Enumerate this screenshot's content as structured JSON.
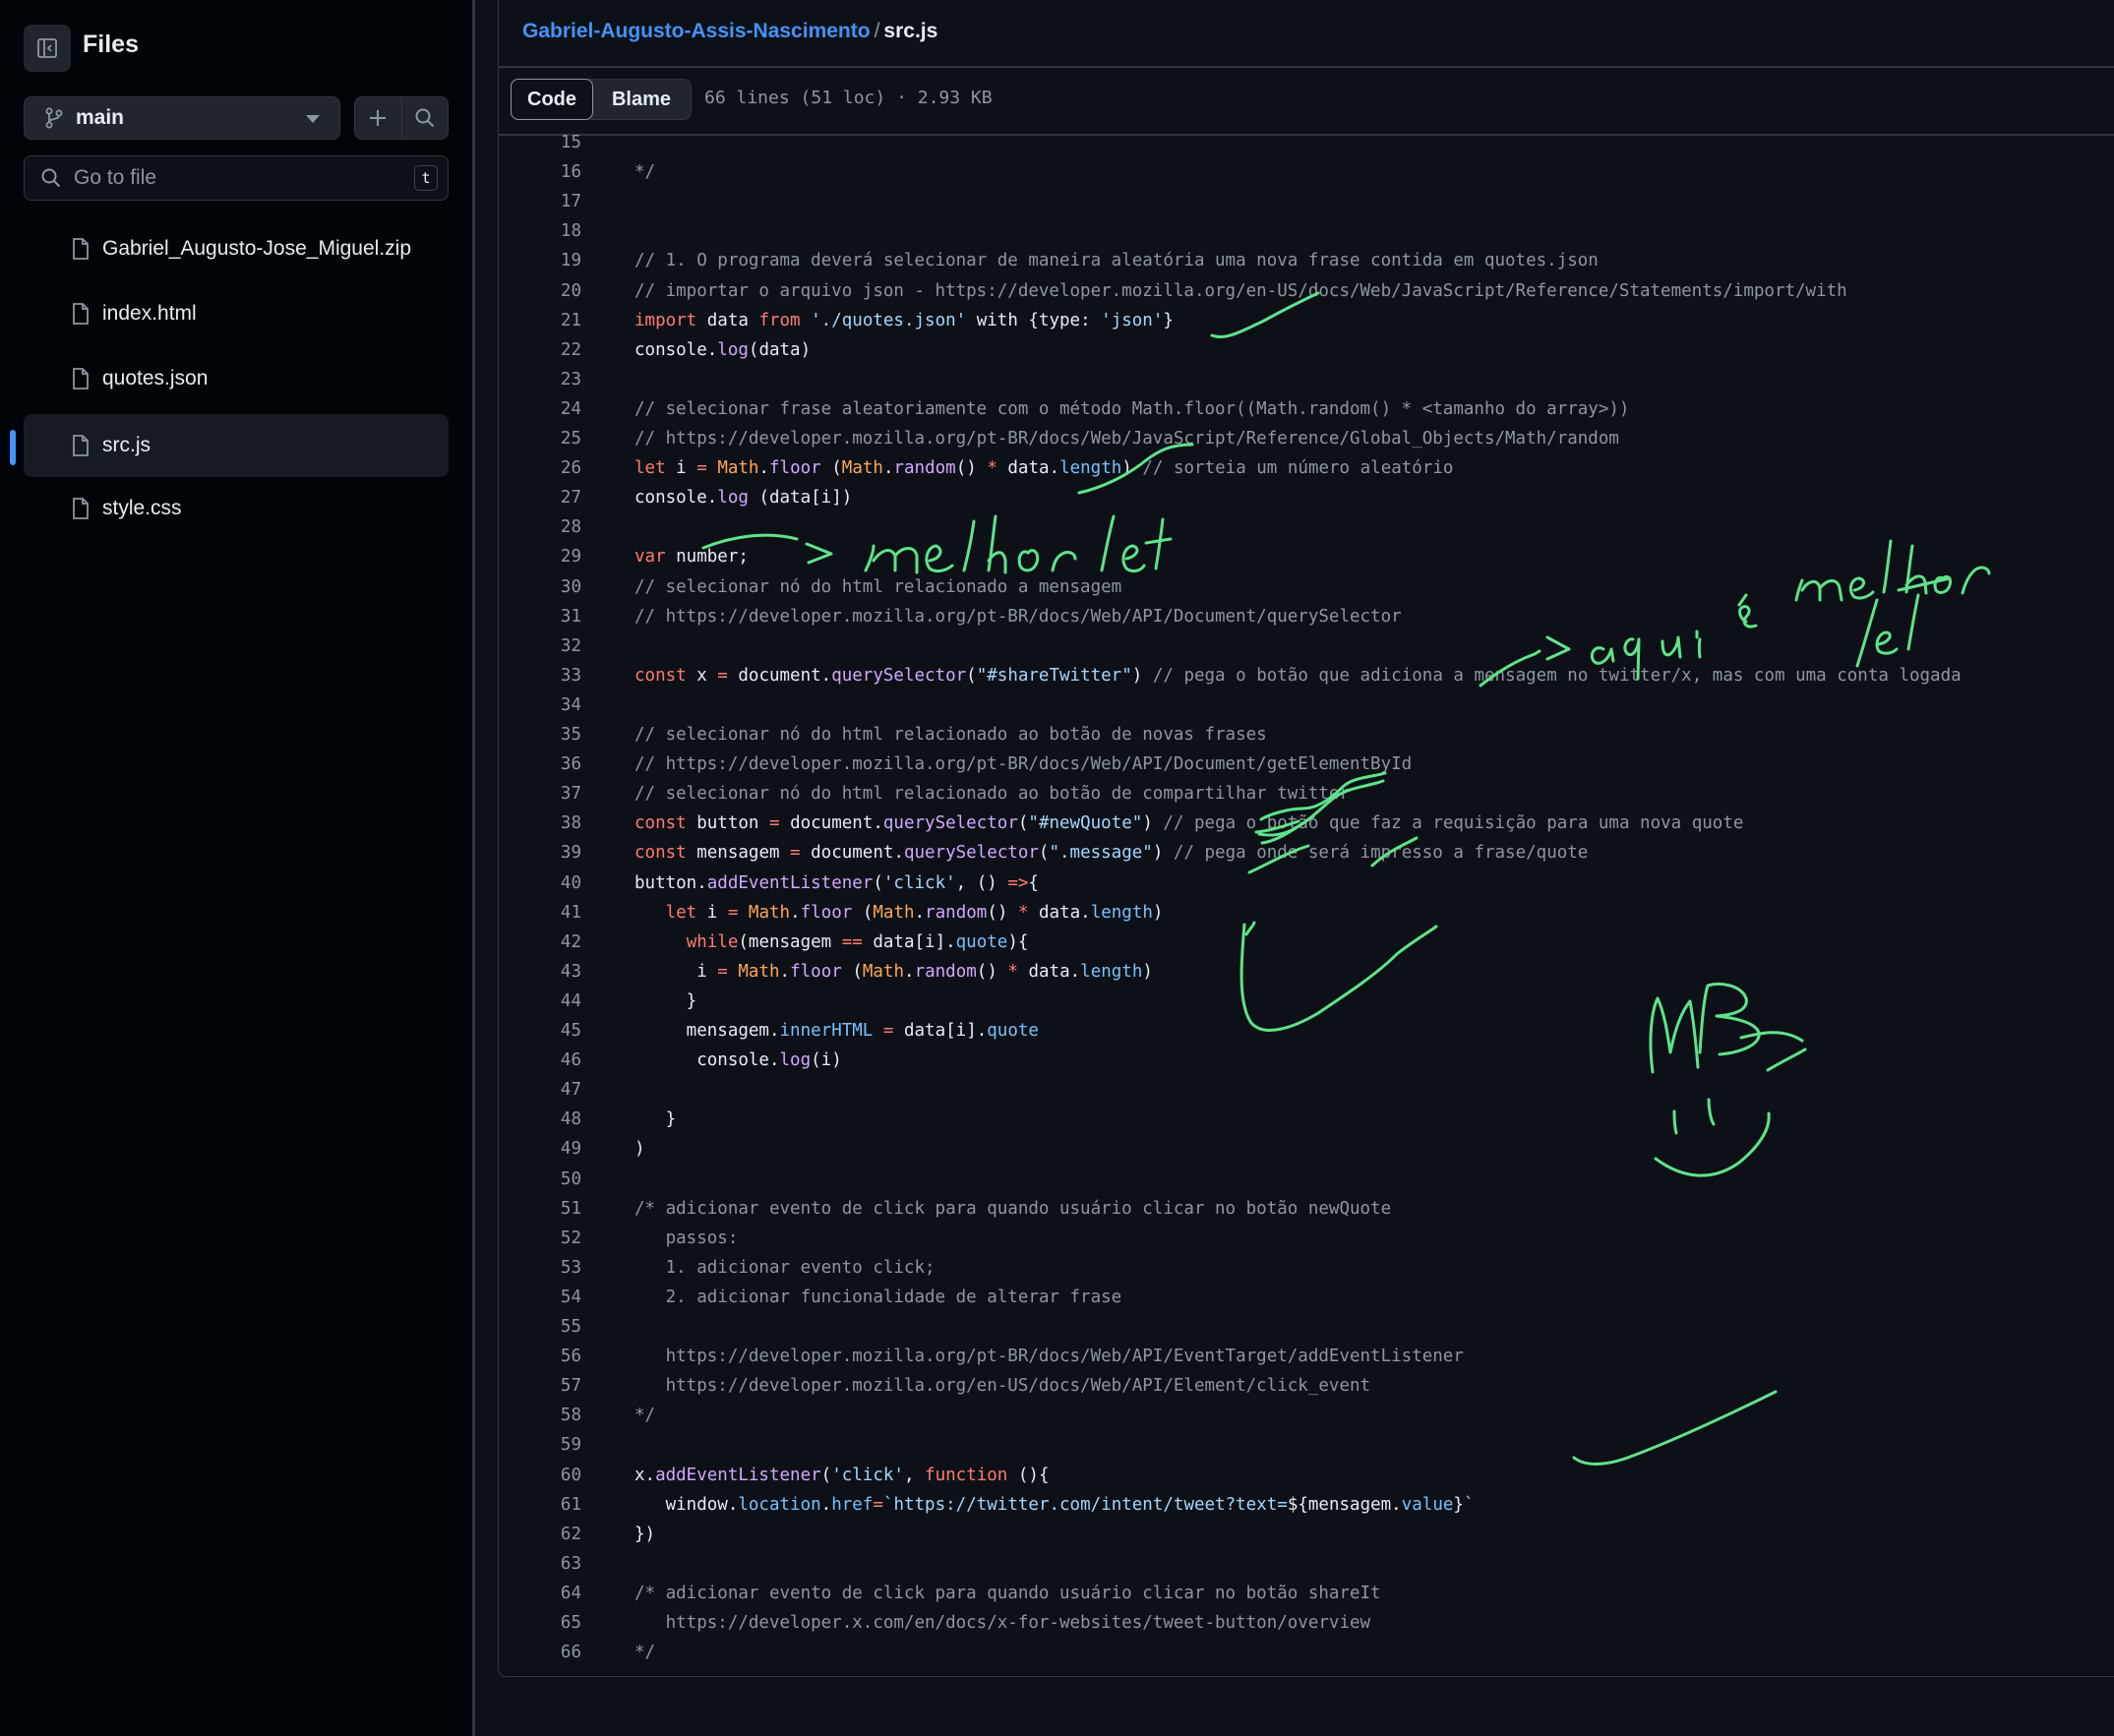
{
  "sidebar": {
    "title": "Files",
    "branch": "main",
    "search_placeholder": "Go to file",
    "search_shortcut": "t",
    "files": [
      {
        "name": "Gabriel_Augusto-Jose_Miguel.zip",
        "active": false
      },
      {
        "name": "index.html",
        "active": false
      },
      {
        "name": "quotes.json",
        "active": false
      },
      {
        "name": "src.js",
        "active": true
      },
      {
        "name": "style.css",
        "active": false
      }
    ]
  },
  "header": {
    "repo": "Gabriel-Augusto-Assis-Nascimento",
    "separator": "/",
    "file": "src.js",
    "tab_code": "Code",
    "tab_blame": "Blame",
    "file_info": "66 lines (51 loc) · 2.93 KB"
  },
  "code": {
    "lines": [
      {
        "n": "15",
        "html": ""
      },
      {
        "n": "16",
        "html": "<span class=\"c\">*/</span>"
      },
      {
        "n": "17",
        "html": ""
      },
      {
        "n": "18",
        "html": ""
      },
      {
        "n": "19",
        "html": "<span class=\"c\">// 1. O programa deverá selecionar de maneira aleatória uma nova frase contida em quotes.json</span>"
      },
      {
        "n": "20",
        "html": "<span class=\"c\">// importar o arquivo json - https://developer.mozilla.org/en-US/docs/Web/JavaScript/Reference/Statements/import/with</span>"
      },
      {
        "n": "21",
        "html": "<span class=\"k\">import</span> data <span class=\"k\">from</span> <span class=\"s\">'./quotes.json'</span> with {type: <span class=\"s\">'json'</span>}"
      },
      {
        "n": "22",
        "html": "console.<span class=\"f\">log</span>(data)"
      },
      {
        "n": "23",
        "html": ""
      },
      {
        "n": "24",
        "html": "<span class=\"c\">// selecionar frase aleatoriamente com o método Math.floor((Math.random() * &lt;tamanho do array&gt;))</span>"
      },
      {
        "n": "25",
        "html": "<span class=\"c\">// https://developer.mozilla.org/pt-BR/docs/Web/JavaScript/Reference/Global_Objects/Math/random</span>"
      },
      {
        "n": "26",
        "html": "<span class=\"k\">let</span> i <span class=\"k\">=</span> <span class=\"o\">Math</span>.<span class=\"f\">floor</span> (<span class=\"o\">Math</span>.<span class=\"f\">random</span>() <span class=\"k\">*</span> data.<span class=\"p\">length</span>) <span class=\"c\">// sorteia um número aleatório</span>"
      },
      {
        "n": "27",
        "html": "console.<span class=\"f\">log</span> (data[i])"
      },
      {
        "n": "28",
        "html": ""
      },
      {
        "n": "29",
        "html": "<span class=\"k\">var</span> number;"
      },
      {
        "n": "30",
        "html": "<span class=\"c\">// selecionar nó do html relacionado a mensagem</span>"
      },
      {
        "n": "31",
        "html": "<span class=\"c\">// https://developer.mozilla.org/pt-BR/docs/Web/API/Document/querySelector</span>"
      },
      {
        "n": "32",
        "html": ""
      },
      {
        "n": "33",
        "html": "<span class=\"k\">const</span> x <span class=\"k\">=</span> document.<span class=\"f\">querySelector</span>(<span class=\"s\">\"#shareTwitter\"</span>) <span class=\"c\">// pega o botão que adiciona a mensagem no twitter/x, mas com uma conta logada</span>"
      },
      {
        "n": "34",
        "html": ""
      },
      {
        "n": "35",
        "html": "<span class=\"c\">// selecionar nó do html relacionado ao botão de novas frases</span>"
      },
      {
        "n": "36",
        "html": "<span class=\"c\">// https://developer.mozilla.org/pt-BR/docs/Web/API/Document/getElementById</span>"
      },
      {
        "n": "37",
        "html": "<span class=\"c\">// selecionar nó do html relacionado ao botão de compartilhar twitter</span>"
      },
      {
        "n": "38",
        "html": "<span class=\"k\">const</span> button <span class=\"k\">=</span> document.<span class=\"f\">querySelector</span>(<span class=\"s\">\"#newQuote\"</span>) <span class=\"c\">// pega o botão que faz a requisição para uma nova quote</span>"
      },
      {
        "n": "39",
        "html": "<span class=\"k\">const</span> mensagem <span class=\"k\">=</span> document.<span class=\"f\">querySelector</span>(<span class=\"s\">\".message\"</span>) <span class=\"c\">// pega onde será impresso a frase/quote</span>"
      },
      {
        "n": "40",
        "html": "button.<span class=\"f\">addEventListener</span>(<span class=\"s\">'click'</span>, () <span class=\"k\">=&gt;</span>{"
      },
      {
        "n": "41",
        "html": "   <span class=\"k\">let</span> i <span class=\"k\">=</span> <span class=\"o\">Math</span>.<span class=\"f\">floor</span> (<span class=\"o\">Math</span>.<span class=\"f\">random</span>() <span class=\"k\">*</span> data.<span class=\"p\">length</span>)"
      },
      {
        "n": "42",
        "html": "     <span class=\"k\">while</span>(mensagem <span class=\"k\">==</span> data[i].<span class=\"p\">quote</span>){"
      },
      {
        "n": "43",
        "html": "      i <span class=\"k\">=</span> <span class=\"o\">Math</span>.<span class=\"f\">floor</span> (<span class=\"o\">Math</span>.<span class=\"f\">random</span>() <span class=\"k\">*</span> data.<span class=\"p\">length</span>)"
      },
      {
        "n": "44",
        "html": "     }"
      },
      {
        "n": "45",
        "html": "     mensagem.<span class=\"p\">innerHTML</span> <span class=\"k\">=</span> data[i].<span class=\"p\">quote</span>"
      },
      {
        "n": "46",
        "html": "      console.<span class=\"f\">log</span>(i)"
      },
      {
        "n": "47",
        "html": ""
      },
      {
        "n": "48",
        "html": "   }"
      },
      {
        "n": "49",
        "html": ")"
      },
      {
        "n": "50",
        "html": ""
      },
      {
        "n": "51",
        "html": "<span class=\"c\">/* adicionar evento de click para quando usuário clicar no botão newQuote</span>"
      },
      {
        "n": "52",
        "html": "<span class=\"c\">   passos:</span>"
      },
      {
        "n": "53",
        "html": "<span class=\"c\">   1. adicionar evento click;</span>"
      },
      {
        "n": "54",
        "html": "<span class=\"c\">   2. adicionar funcionalidade de alterar frase</span>"
      },
      {
        "n": "55",
        "html": ""
      },
      {
        "n": "56",
        "html": "<span class=\"c\">   https://developer.mozilla.org/pt-BR/docs/Web/API/EventTarget/addEventListener</span>"
      },
      {
        "n": "57",
        "html": "<span class=\"c\">   https://developer.mozilla.org/en-US/docs/Web/API/Element/click_event</span>"
      },
      {
        "n": "58",
        "html": "<span class=\"c\">*/</span>"
      },
      {
        "n": "59",
        "html": ""
      },
      {
        "n": "60",
        "html": "x.<span class=\"f\">addEventListener</span>(<span class=\"s\">'click'</span>, <span class=\"k\">function</span> (){"
      },
      {
        "n": "61",
        "html": "   window.<span class=\"p\">location</span>.<span class=\"p\">href</span><span class=\"k\">=</span><span class=\"s\">`https://twitter.com/intent/tweet?text=</span>${mensagem.<span class=\"p\">value</span>}<span class=\"s\">`</span>"
      },
      {
        "n": "62",
        "html": "})"
      },
      {
        "n": "63",
        "html": ""
      },
      {
        "n": "64",
        "html": "<span class=\"c\">/* adicionar evento de click para quando usuário clicar no botão shareIt</span>"
      },
      {
        "n": "65",
        "html": "<span class=\"c\">   https://developer.x.com/en/docs/x-for-websites/tweet-button/overview</span>"
      },
      {
        "n": "66",
        "html": "<span class=\"c\">*/</span>"
      }
    ]
  },
  "annotations": {
    "color": "#5fe38a",
    "handwritten_texts": [
      "-> melhor let",
      "-> aqui é melhor let",
      "MB",
      ":)"
    ]
  },
  "colors": {
    "bg": "#0d1117",
    "sidebar_bg": "#010409",
    "link": "#4493f8",
    "keyword": "#ff7b72",
    "string": "#a5d6ff",
    "function": "#d2a8ff",
    "property": "#79c0ff",
    "constant": "#ffa657",
    "comment": "#8d96a0"
  }
}
